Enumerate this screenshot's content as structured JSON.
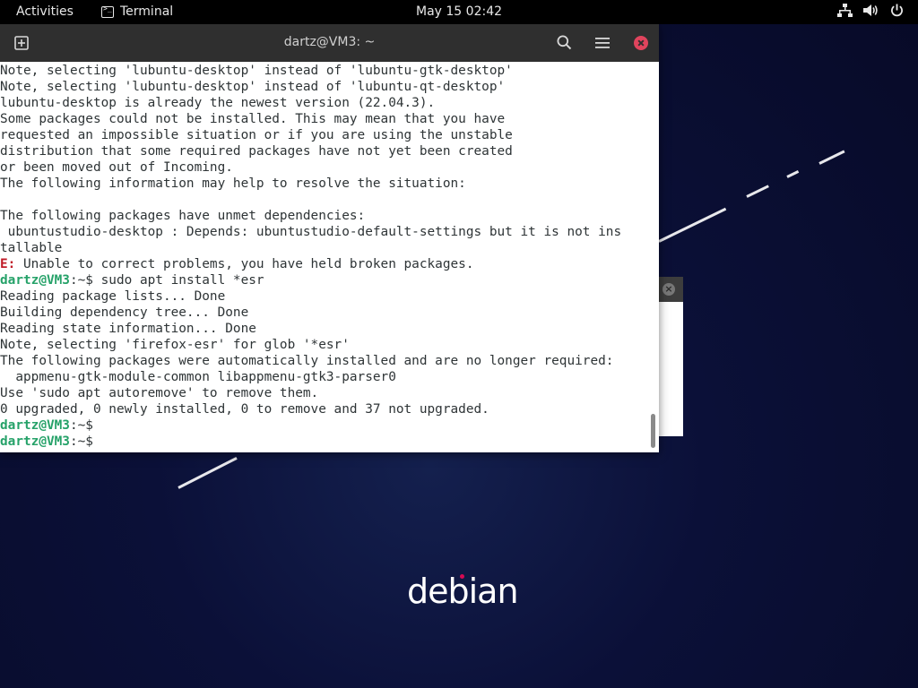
{
  "topbar": {
    "activities": "Activities",
    "app_name": "Terminal",
    "clock": "May 15  02:42",
    "icons": [
      "network-icon",
      "volume-icon",
      "power-icon"
    ]
  },
  "terminal": {
    "title": "dartz@VM3: ~",
    "lines": [
      {
        "type": "text",
        "text": "Note, selecting 'lubuntu-desktop' instead of 'lubuntu-gtk-desktop'"
      },
      {
        "type": "text",
        "text": "Note, selecting 'lubuntu-desktop' instead of 'lubuntu-qt-desktop'"
      },
      {
        "type": "text",
        "text": "lubuntu-desktop is already the newest version (22.04.3)."
      },
      {
        "type": "text",
        "text": "Some packages could not be installed. This may mean that you have"
      },
      {
        "type": "text",
        "text": "requested an impossible situation or if you are using the unstable"
      },
      {
        "type": "text",
        "text": "distribution that some required packages have not yet been created"
      },
      {
        "type": "text",
        "text": "or been moved out of Incoming."
      },
      {
        "type": "text",
        "text": "The following information may help to resolve the situation:"
      },
      {
        "type": "text",
        "text": ""
      },
      {
        "type": "text",
        "text": "The following packages have unmet dependencies:"
      },
      {
        "type": "text",
        "text": " ubuntustudio-desktop : Depends: ubuntustudio-default-settings but it is not ins"
      },
      {
        "type": "text",
        "text": "tallable"
      },
      {
        "type": "error",
        "prefix": "E:",
        "text": " Unable to correct problems, you have held broken packages."
      },
      {
        "type": "prompt",
        "user": "dartz@VM3",
        "path": ":~$",
        "text": " sudo apt install *esr"
      },
      {
        "type": "text",
        "text": "Reading package lists... Done"
      },
      {
        "type": "text",
        "text": "Building dependency tree... Done"
      },
      {
        "type": "text",
        "text": "Reading state information... Done"
      },
      {
        "type": "text",
        "text": "Note, selecting 'firefox-esr' for glob '*esr'"
      },
      {
        "type": "text",
        "text": "The following packages were automatically installed and are no longer required:"
      },
      {
        "type": "text",
        "text": "  appmenu-gtk-module-common libappmenu-gtk3-parser0"
      },
      {
        "type": "text",
        "text": "Use 'sudo apt autoremove' to remove them."
      },
      {
        "type": "text",
        "text": "0 upgraded, 0 newly installed, 0 to remove and 37 not upgraded."
      },
      {
        "type": "prompt",
        "user": "dartz@VM3",
        "path": ":~$",
        "text": ""
      },
      {
        "type": "prompt",
        "user": "dartz@VM3",
        "path": ":~$",
        "text": ""
      }
    ]
  },
  "desktop": {
    "logo_text": "debian"
  },
  "colors": {
    "prompt_user": "#26a269",
    "error": "#c01c28",
    "close_button": "#e0445d",
    "titlebar": "#2f2f2f"
  }
}
